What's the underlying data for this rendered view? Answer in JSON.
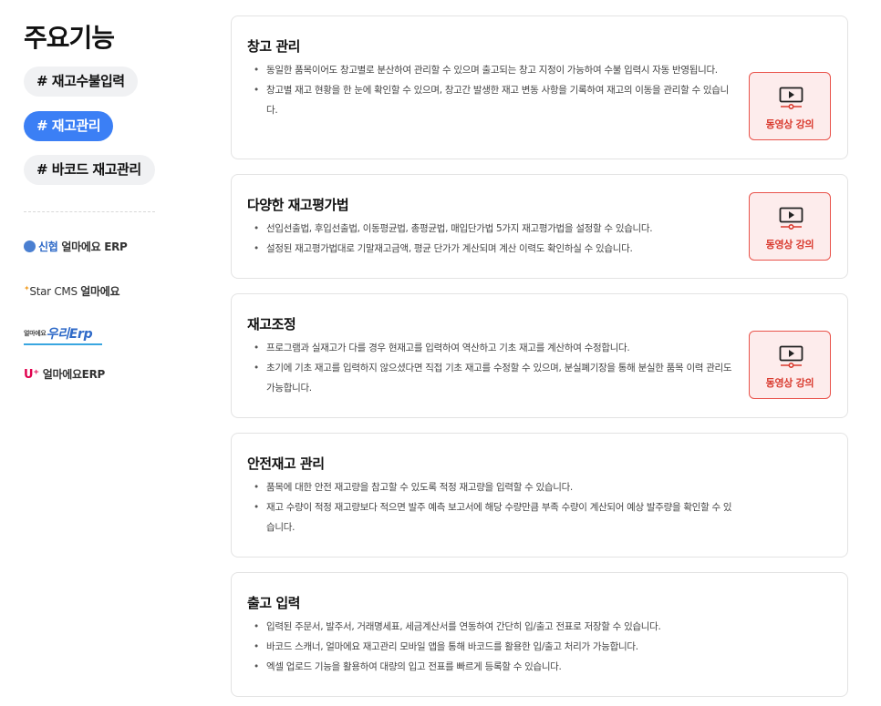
{
  "sidebar": {
    "title": "주요기능",
    "tags": [
      "# 재고수불입력",
      "# 재고관리",
      "# 바코드 재고관리"
    ],
    "active_tag": 1,
    "partners": [
      {
        "brand": "신협",
        "product": "얼마에요 ERP"
      },
      {
        "brand": "Star CMS",
        "product": "얼마에요"
      },
      {
        "brand": "얼마에요",
        "product": "우리Erp"
      },
      {
        "brand": "U⁺",
        "product": "얼마에요ERP"
      }
    ]
  },
  "cards": [
    {
      "title": "창고 관리",
      "bullets": [
        "동일한 품목이어도 창고별로 분산하여 관리할 수 있으며 출고되는 창고 지정이 가능하여 수불 입력시 자동 반영됩니다.",
        "창고별 재고 현황을 한 눈에 확인할 수 있으며, 창고간 발생한 재고 변동 사항을 기록하여 재고의 이동을 관리할 수 있습니다."
      ],
      "video_label": "동영상 강의"
    },
    {
      "title": "다양한 재고평가법",
      "bullets": [
        "선입선출법, 후입선출법, 이동평균법, 총평균법, 매입단가법 5가지 재고평가법을 설정할 수 있습니다.",
        "설정된 재고평가법대로 기말재고금액, 평균 단가가 계산되며 계산 이력도 확인하실 수 있습니다."
      ],
      "video_label": "동영상 강의"
    },
    {
      "title": "재고조정",
      "bullets": [
        "프로그램과 실재고가 다를 경우 현재고를 입력하여 역산하고 기초 재고를 계산하여 수정합니다.",
        "초기에 기초 재고를 입력하지 않으셨다면 직접 기초 재고를 수정할 수 있으며, 분실폐기장을 통해 분실한 품목 이력 관리도 가능합니다."
      ],
      "video_label": "동영상 강의"
    },
    {
      "title": "안전재고 관리",
      "bullets": [
        "품목에 대한 안전 재고량을 참고할 수 있도록 적정 재고량을 입력할 수 있습니다.",
        "재고 수량이 적정 재고량보다 적으면 발주 예측 보고서에 해당 수량만큼 부족 수량이 계산되어 예상 발주량을 확인할 수 있습니다."
      ]
    },
    {
      "title": "출고 입력",
      "bullets": [
        "입력된 주문서, 발주서, 거래명세표, 세금계산서를 연동하여 간단히 입/출고 전표로 저장할 수 있습니다.",
        "바코드 스캐너, 얼마에요 재고관리 모바일 앱을 통해 바코드를 활용한 입/출고 처리가 가능합니다.",
        "엑셀 업로드 기능을 활용하여 대량의 입고 전표를 빠르게 등록할 수 있습니다."
      ]
    }
  ],
  "colors": {
    "accent": "#3b7ff5",
    "video_border": "#e9534b",
    "video_bg": "#fdecec",
    "video_text": "#d93b2f"
  },
  "icons": {
    "video": "play-screen-icon"
  }
}
